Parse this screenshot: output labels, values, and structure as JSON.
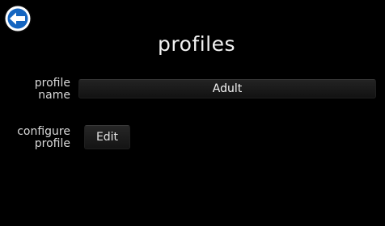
{
  "header": {
    "back_icon": "back-arrow-icon",
    "title": "profiles"
  },
  "form": {
    "profile_name": {
      "label_line1": "profile",
      "label_line2": "name",
      "value": "Adult"
    },
    "configure_profile": {
      "label_line1": "configure",
      "label_line2": "profile",
      "button_label": "Edit"
    }
  },
  "colors": {
    "background": "#000000",
    "accent": "#1565c0",
    "text": "#f2f2f2"
  }
}
